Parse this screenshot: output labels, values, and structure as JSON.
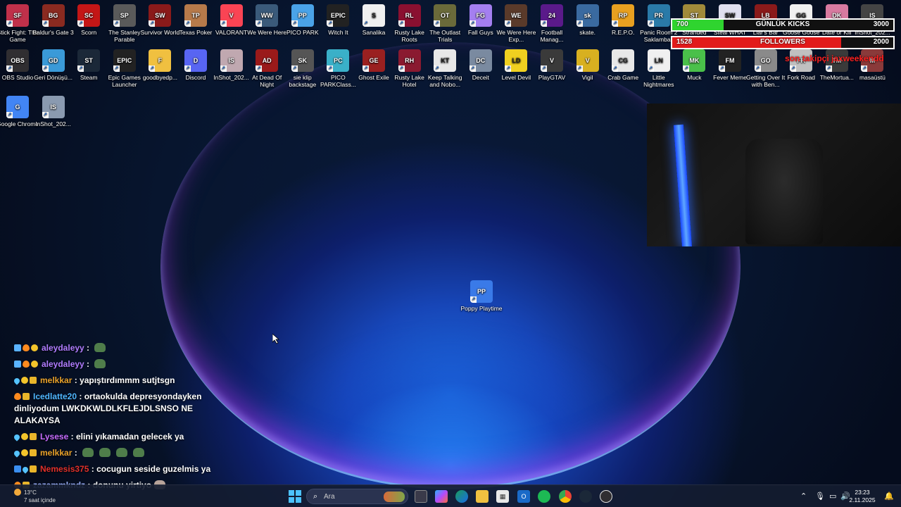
{
  "desktop": {
    "icons": [
      {
        "label": "Stick Fight: The Game",
        "color": "#c0304a",
        "glyph": "SF"
      },
      {
        "label": "Baldur's Gate 3",
        "color": "#8a2a20",
        "glyph": "BG"
      },
      {
        "label": "Scorn",
        "color": "#c41616",
        "glyph": "SC"
      },
      {
        "label": "The Stanley Parable",
        "color": "#5a5a5a",
        "glyph": "SP"
      },
      {
        "label": "Survivor World",
        "color": "#8a1a1a",
        "glyph": "SW"
      },
      {
        "label": "Texas Poker",
        "color": "#b77a4a",
        "glyph": "TP"
      },
      {
        "label": "VALORANT",
        "color": "#fa4454",
        "glyph": "V"
      },
      {
        "label": "We Were Here",
        "color": "#3a5a7a",
        "glyph": "WW"
      },
      {
        "label": "PICO PARK",
        "color": "#4aa3e8",
        "glyph": "PP"
      },
      {
        "label": "Witch It",
        "color": "#222222",
        "glyph": "EPIC"
      },
      {
        "label": "Sanalika",
        "color": "#f0f0f0",
        "glyph": "S"
      },
      {
        "label": "Rusty Lake Roots",
        "color": "#8a1030",
        "glyph": "RL"
      },
      {
        "label": "The Outlast Trials",
        "color": "#6a6a3a",
        "glyph": "OT"
      },
      {
        "label": "Fall Guys",
        "color": "#a47ff0",
        "glyph": "FG"
      },
      {
        "label": "We Were Here Exp...",
        "color": "#5a3a2a",
        "glyph": "WE"
      },
      {
        "label": "Football Manag...",
        "color": "#5a1a8a",
        "glyph": "24"
      },
      {
        "label": "skate.",
        "color": "#3a6aa0",
        "glyph": "sk"
      },
      {
        "label": "R.E.P.O.",
        "color": "#e8a020",
        "glyph": "RP"
      },
      {
        "label": "Panic Room 2 Saklambaç",
        "color": "#2a7aa8",
        "glyph": "PR"
      },
      {
        "label": "Stranded",
        "color": "#a08a3a",
        "glyph": "ST"
      },
      {
        "label": "Steal WHAT",
        "color": "#e0e0f0",
        "glyph": "SW"
      },
      {
        "label": "Liar's Bar",
        "color": "#8a1a1a",
        "glyph": "LB"
      },
      {
        "label": "Goose Goose Duck",
        "color": "#f0f0f0",
        "glyph": "GG"
      },
      {
        "label": "Date or Kill",
        "color": "#d87aa0",
        "glyph": "DK"
      },
      {
        "label": "InShot_202...",
        "color": "#444444",
        "glyph": "IS"
      },
      {
        "label": "OBS Studio",
        "color": "#302e31",
        "glyph": "OBS"
      },
      {
        "label": "Geri Dönüşü...",
        "color": "#3a9ad8",
        "glyph": "GD"
      },
      {
        "label": "Steam",
        "color": "#1b2838",
        "glyph": "ST"
      },
      {
        "label": "Epic Games Launcher",
        "color": "#222222",
        "glyph": "EPIC"
      },
      {
        "label": "goodbyedp...",
        "color": "#f0c040",
        "glyph": "F"
      },
      {
        "label": "Discord",
        "color": "#5865f2",
        "glyph": "D"
      },
      {
        "label": "InShot_202...",
        "color": "#c0a8b0",
        "glyph": "IS"
      },
      {
        "label": "At Dead Of Night",
        "color": "#9a1a1a",
        "glyph": "AD"
      },
      {
        "label": "sie klip backstage",
        "color": "#555555",
        "glyph": "SK"
      },
      {
        "label": "PICO PARKClass...",
        "color": "#3ab0c8",
        "glyph": "PC"
      },
      {
        "label": "Ghost Exile",
        "color": "#9a2020",
        "glyph": "GE"
      },
      {
        "label": "Rusty Lake Hotel",
        "color": "#8a1a30",
        "glyph": "RH"
      },
      {
        "label": "Keep Talking and Nobo...",
        "color": "#e8e8e8",
        "glyph": "KT"
      },
      {
        "label": "Deceit",
        "color": "#7a8aa0",
        "glyph": "DC"
      },
      {
        "label": "Level Devil",
        "color": "#f0d020",
        "glyph": "LD"
      },
      {
        "label": "PlayGTAV",
        "color": "#3a3a3a",
        "glyph": "V"
      },
      {
        "label": "Vigil",
        "color": "#d8b020",
        "glyph": "V"
      },
      {
        "label": "Crab Game",
        "color": "#e8e8e8",
        "glyph": "CG"
      },
      {
        "label": "Little Nightmares",
        "color": "#f0f0f0",
        "glyph": "LN"
      },
      {
        "label": "Muck",
        "color": "#4ac04a",
        "glyph": "MK"
      },
      {
        "label": "Fever Meme",
        "color": "#222222",
        "glyph": "FM"
      },
      {
        "label": "Getting Over It with Ben...",
        "color": "#8a8a8a",
        "glyph": "GO"
      },
      {
        "label": "Fork Road",
        "color": "#c0c0c0",
        "glyph": "FR"
      },
      {
        "label": "TheMortua...",
        "color": "#3a3a3a",
        "glyph": "TM"
      },
      {
        "label": "masaüstü",
        "color": "#8a3a3a",
        "glyph": "M"
      },
      {
        "label": "Google Chrome",
        "color": "#4285f4",
        "glyph": "G"
      },
      {
        "label": "InShot_202...",
        "color": "#8a9ab0",
        "glyph": "IS"
      },
      {
        "label": "Poppy Playtime",
        "color": "#3a7ae8",
        "glyph": "PP"
      }
    ]
  },
  "overlays": {
    "kicks_bar": {
      "current": "700",
      "label": "GÜNLÜK KICKS",
      "goal": "3000",
      "fill_color": "#2fd42f",
      "progress": 0.233
    },
    "followers_bar": {
      "current": "1528",
      "label": "FOLLOWERS",
      "goal": "2000",
      "fill_color": "#e21b1b",
      "progress": 0.764
    },
    "sub_message": "son takipçi jaxweekendd"
  },
  "chat": [
    {
      "user": "aleydaleyy",
      "user_color": "#b07cff",
      "sep": " : ",
      "text": "",
      "emotes": 1
    },
    {
      "user": "aleydaleyy",
      "user_color": "#b07cff",
      "sep": " : ",
      "text": "",
      "emotes": 1
    },
    {
      "user": "melkkar",
      "user_color": "#e8a12a",
      "sep": " : ",
      "text": "yapıştırdımmm sutjtsgn",
      "emotes": 0
    },
    {
      "user": "Icedlatte20",
      "user_color": "#4fb6ff",
      "sep": " : ",
      "text": "ortaokulda depresyondayken dinliyodum LWKDKWLDLKFLEJDLSNSO NE ALAKAYSA",
      "emotes": 0
    },
    {
      "user": "Lysese",
      "user_color": "#c86cff",
      "sep": " : ",
      "text": "elini yıkamadan gelecek ya",
      "emotes": 0
    },
    {
      "user": "melkkar",
      "user_color": "#e8a12a",
      "sep": " : ",
      "text": "",
      "emotes": 4
    },
    {
      "user": "Nemesis375",
      "user_color": "#e0302a",
      "sep": " : ",
      "text": "cocugun seside guzelmis ya",
      "emotes": 0
    },
    {
      "user": "zazammkndz",
      "user_color": "#9ab0ff",
      "sep": " : ",
      "text": "donunu yirtiyo",
      "emotes": 1
    }
  ],
  "taskbar": {
    "weather_temp": "13°C",
    "weather_sub": "7 saat içinde",
    "search_placeholder": "Ara",
    "time": "23:23",
    "date": "2.11.2025"
  }
}
